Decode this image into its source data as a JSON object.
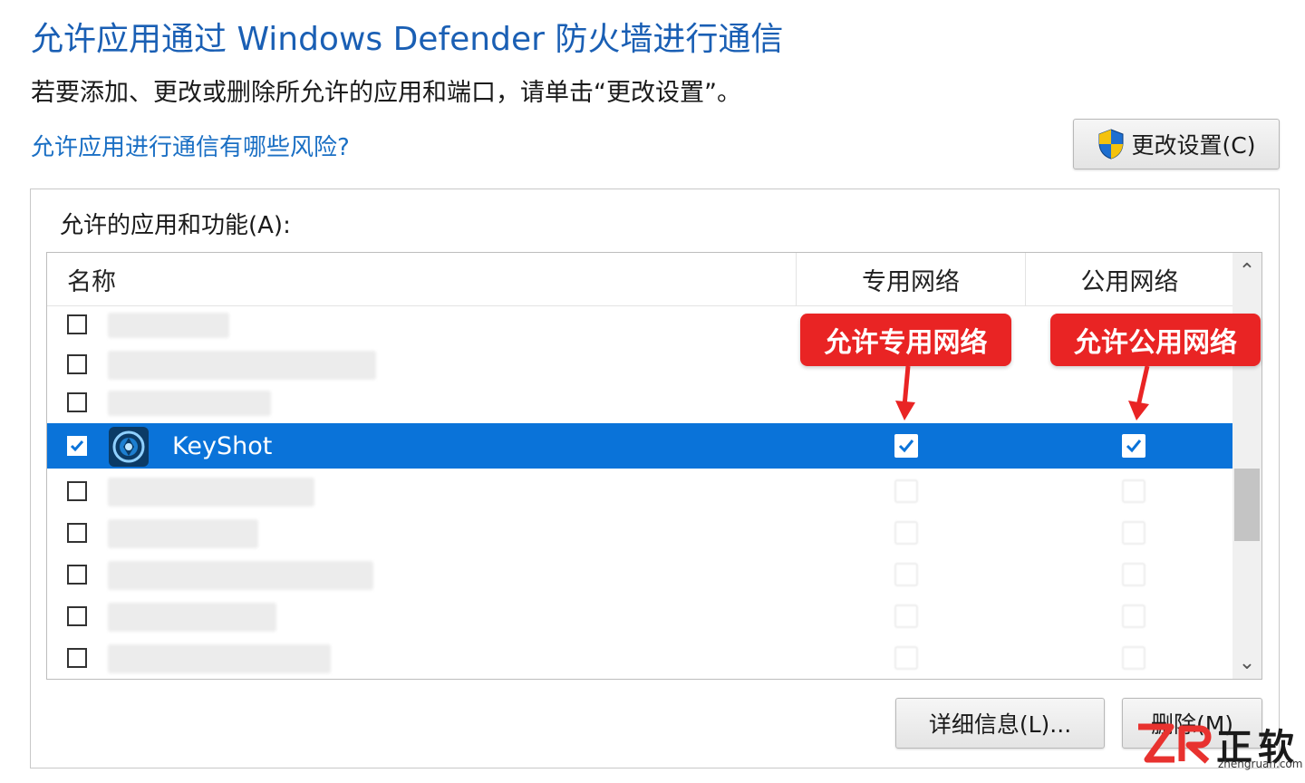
{
  "page": {
    "title": "允许应用通过 Windows Defender 防火墙进行通信",
    "subtitle": "若要添加、更改或删除所允许的应用和端口，请单击“更改设置”。",
    "risk_link": "允许应用进行通信有哪些风险?",
    "change_settings_label": "更改设置(C)"
  },
  "group": {
    "label": "允许的应用和功能(A):",
    "columns": {
      "name": "名称",
      "private": "专用网络",
      "public": "公用网络"
    }
  },
  "apps": {
    "selected": {
      "name": "KeyShot",
      "enabled": true,
      "private": true,
      "public": true,
      "icon": "keyshot-logo-icon"
    }
  },
  "annotations": {
    "private_callout": "允许专用网络",
    "public_callout": "允许公用网络"
  },
  "buttons": {
    "details": "详细信息(L)...",
    "remove": "删除(M)"
  },
  "watermark": {
    "text": "正软",
    "url": "zhengruan.com"
  },
  "colors": {
    "accent": "#1a5fb4",
    "selection": "#0a73d9",
    "callout": "#e92424"
  }
}
